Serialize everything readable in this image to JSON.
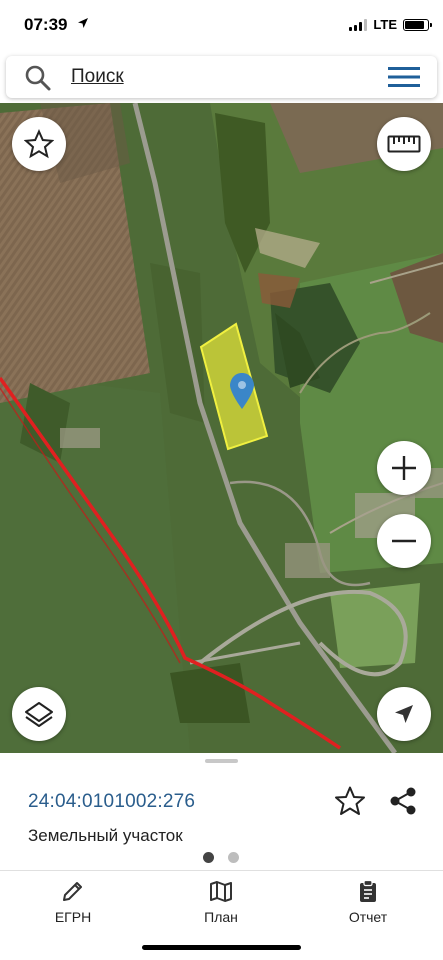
{
  "status_bar": {
    "time": "07:39",
    "network": "LTE"
  },
  "search": {
    "placeholder": "Поиск"
  },
  "map": {
    "parcel_color": "#e0e23a",
    "pin_color": "#3a86c8",
    "road_color": "#e02020"
  },
  "parcel": {
    "cadastral_number": "24:04:0101002:276",
    "type": "Земельный участок"
  },
  "pager": {
    "active_index": 0,
    "count": 2
  },
  "tabs": [
    {
      "label": "ЕГРН",
      "icon": "pencil-icon"
    },
    {
      "label": "План",
      "icon": "map-icon"
    },
    {
      "label": "Отчет",
      "icon": "clipboard-icon"
    }
  ],
  "colors": {
    "accent": "#2a5d8c",
    "menu": "#1f5f99"
  }
}
